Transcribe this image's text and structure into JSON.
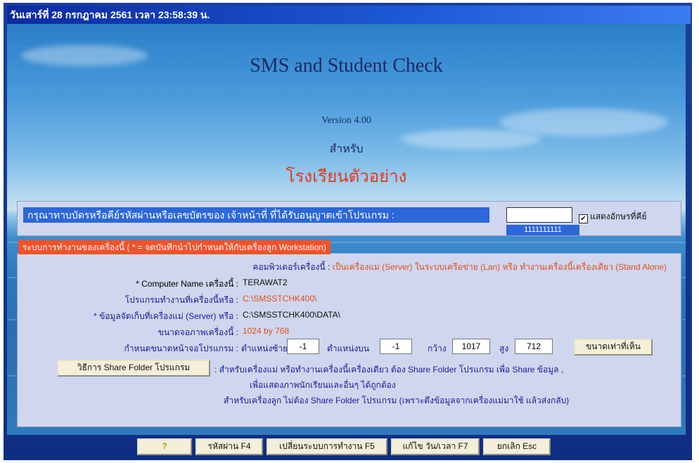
{
  "window": {
    "title": "วันเสาร์ที่ 28 กรกฎาคม 2561 เวลา 23:58:39 น."
  },
  "header": {
    "app_title": "SMS and Student Check",
    "version": "Version 4.00",
    "for_label": "สำหรับ",
    "school_name": "โรงเรียนตัวอย่าง"
  },
  "login": {
    "prompt": "กรุณาทาบบัตรหรือคีย์รหัสผ่านหรือเลขบัตรของ เจ้าหน้าที่ ที่ได้รับอนุญาตเข้าโปรแกรม :",
    "password_value": "",
    "password_echo": "1111111111",
    "show_chars_label": "แสดงอักษรที่คีย์",
    "show_chars_checked": true
  },
  "system": {
    "header": "ระบบการทำงานของเครื่องนี้ ( * = จดบันทึกนำไปกำหนดให้กับเครื่องลูก Workstation)",
    "computer_label": "คอมพิวเตอร์เครื่องนี้ :",
    "computer_value": "เป็นเครื่องแม่ (Server) ในระบบเครือข่าย (Lan) หรือ ทำงานเครื่องนี้เครื่องเดียว (Stand Alone)",
    "name_label": "* Computer Name เครื่องนี้ :",
    "name_value": "TERAWAT2",
    "program_label": "โปรแกรมทำงานที่เครื่องนี้หรือ :",
    "program_value": "C:\\SMSSTCHK400\\",
    "data_label": "* ข้อมูลจัดเก็บที่เครื่องแม่ (Server) หรือ :",
    "data_value": "C:\\SMSSTCHK400\\DATA\\",
    "screen_label": "ขนาดจอภาพเครื่องนี้ :",
    "screen_value": "1024 by 768",
    "window_size_label": "กำหนดขนาดหน้าจอโปรแกรม :",
    "left_label": "ตำแหน่งซ้าย",
    "left_value": "-1",
    "top_label": "ตำแหน่งบน",
    "top_value": "-1",
    "width_label": "กว้าง",
    "width_value": "1017",
    "height_label": "สูง",
    "height_value": "712",
    "fit_button": "ขนาดเท่าที่เห็น",
    "share_button": "วิธีการ Share Folder โปรแกรม",
    "share_note1": ": สำหรับเครื่องแม่ หรือทำงานเครื่องนี้เครื่องเดียว ต้อง Share Folder โปรแกรม เพื่อ Share ข้อมูล ,",
    "share_note2": "เพื่อแสดงภาพนักเรียนและอื่นๆ ได้ถูกต้อง",
    "share_note3": "สำหรับเครื่องลูก ไม่ต้อง Share Folder โปรแกรม (เพราะดึงข้อมูลจากเครื่องแม่มาใช้ แล้วส่งกลับ)"
  },
  "toolbar": {
    "help_icon": "key-icon",
    "password_button": "รหัสผ่าน F4",
    "mode_button": "เปลี่ยนระบบการทำงาน F5",
    "datetime_button": "แก้ไข วัน/เวลา F7",
    "cancel_button": "ยกเลิก Esc"
  },
  "colors": {
    "title_bar": "#0c2aa0",
    "prompt_bg": "#2d67d8",
    "section_header": "#f0522a",
    "panel_bg": "#cfd6ee",
    "school_text": "#e03a20"
  }
}
